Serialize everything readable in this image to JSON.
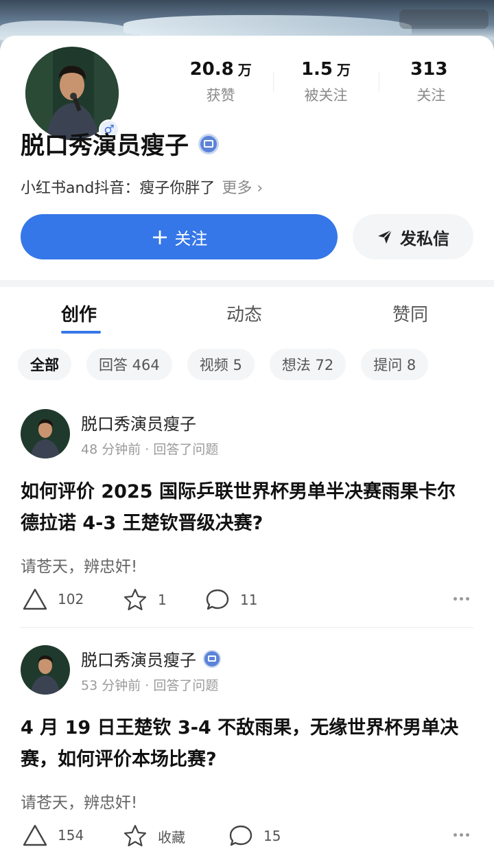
{
  "profile": {
    "name": "脱口秀演员瘦子",
    "gender_icon": "♂",
    "bio": "小红书and抖音：瘦子你胖了",
    "bio_more": "更多 ›",
    "stats": [
      {
        "num": "20.8",
        "unit": "万",
        "label": "获赞"
      },
      {
        "num": "1.5",
        "unit": "万",
        "label": "被关注"
      },
      {
        "num": "313",
        "unit": "",
        "label": "关注"
      }
    ],
    "follow_plus": "+",
    "follow_label": "关注",
    "message_label": "发私信"
  },
  "tabs": [
    "创作",
    "动态",
    "赞同"
  ],
  "filters": [
    "全部",
    "回答 464",
    "视频 5",
    "想法 72",
    "提问 8"
  ],
  "posts": [
    {
      "author": "脱口秀演员瘦子",
      "meta": "48 分钟前 · 回答了问题",
      "title": "如何评价 2025 国际乒联世界杯男单半决赛雨果卡尔德拉诺 4-3 王楚钦晋级决赛?",
      "excerpt": "请苍天，辨忠奸!",
      "upvotes": "102",
      "favorites": "1",
      "comments": "11"
    },
    {
      "author": "脱口秀演员瘦子",
      "meta": "53 分钟前 · 回答了问题",
      "title": "4 月 19 日王楚钦 3-4 不敌雨果，无缘世界杯男单决赛，如何评价本场比赛?",
      "excerpt": "请苍天，辨忠奸!",
      "upvotes": "154",
      "favorites": "收藏",
      "comments": "15"
    }
  ],
  "colors": {
    "accent": "#3577e8",
    "verified": "#5b84d8"
  }
}
